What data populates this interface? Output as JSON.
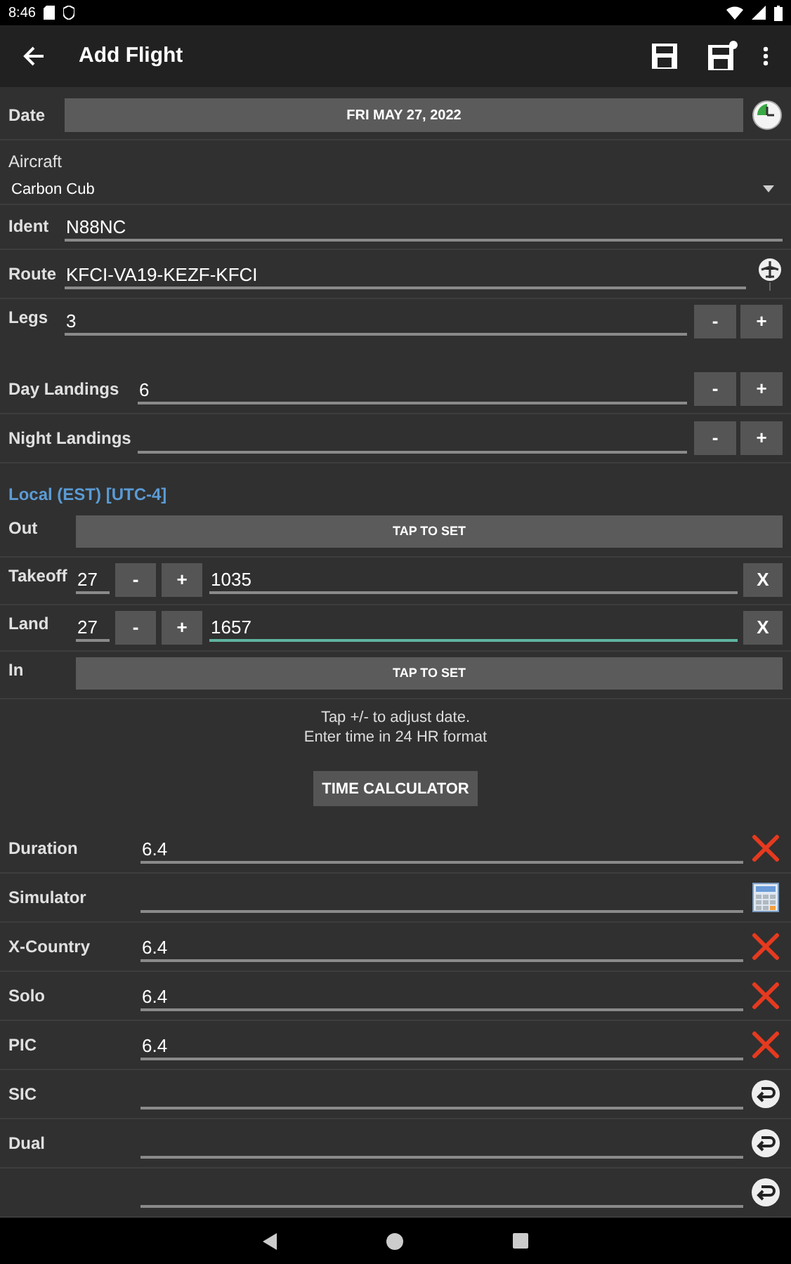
{
  "status_bar": {
    "time": "8:46"
  },
  "toolbar": {
    "title": "Add Flight"
  },
  "date": {
    "label": "Date",
    "value": "FRI MAY 27, 2022"
  },
  "aircraft": {
    "label": "Aircraft",
    "value": "Carbon Cub"
  },
  "ident": {
    "label": "Ident",
    "value": "N88NC"
  },
  "route": {
    "label": "Route",
    "value": "KFCI-VA19-KEZF-KFCI"
  },
  "counters": [
    {
      "label": "Legs",
      "value": "3",
      "minus": "-",
      "plus": "+"
    },
    {
      "label": "Day Landings",
      "value": "6",
      "minus": "-",
      "plus": "+"
    },
    {
      "label": "Night Landings",
      "minus": "-",
      "plus": "+"
    }
  ],
  "time_zone": "Local (EST) [UTC-4]",
  "times": [
    {
      "kind": "tap",
      "label": "Out",
      "button": "TAP TO SET"
    },
    {
      "kind": "entry",
      "label": "Takeoff",
      "day": "27",
      "minus": "-",
      "plus": "+",
      "value": "1035",
      "clear": "X",
      "focused": false
    },
    {
      "kind": "entry",
      "label": "Land",
      "day": "27",
      "minus": "-",
      "plus": "+",
      "value": "1657",
      "clear": "X",
      "focused": true
    },
    {
      "kind": "tap",
      "label": "In",
      "button": "TAP TO SET"
    }
  ],
  "hint": [
    "Tap +/- to adjust date.",
    "Enter time in 24 HR format"
  ],
  "time_calculator": "TIME CALCULATOR",
  "totals": [
    {
      "label": "Duration",
      "value": "6.4",
      "kind": "clear"
    },
    {
      "label": "Simulator",
      "kind": "calculator"
    },
    {
      "label": "X-Country",
      "value": "6.4",
      "kind": "clear"
    },
    {
      "label": "Solo",
      "value": "6.4",
      "kind": "clear"
    },
    {
      "label": "PIC",
      "value": "6.4",
      "kind": "clear"
    },
    {
      "label": "SIC",
      "kind": "copy"
    },
    {
      "label": "Dual",
      "kind": "copy"
    },
    {
      "kind": "copy"
    }
  ]
}
